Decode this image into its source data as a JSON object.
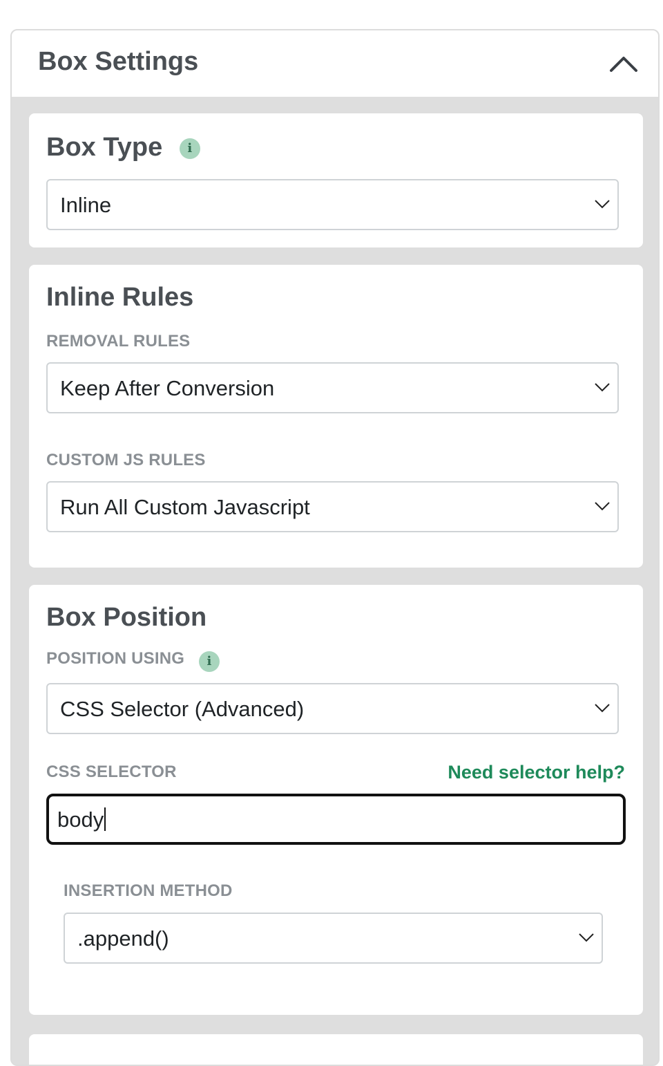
{
  "panel": {
    "title": "Box Settings",
    "collapse_icon": "chevron-up-icon"
  },
  "box_type": {
    "title": "Box Type",
    "info_icon": "info-icon",
    "info_glyph": "i",
    "select_value": "Inline"
  },
  "inline_rules": {
    "title": "Inline Rules",
    "removal_label": "REMOVAL RULES",
    "removal_value": "Keep After Conversion",
    "custom_js_label": "CUSTOM JS RULES",
    "custom_js_value": "Run All Custom Javascript"
  },
  "box_position": {
    "title": "Box Position",
    "position_label": "POSITION USING",
    "info_glyph": "i",
    "position_value": "CSS Selector (Advanced)",
    "css_selector_label": "CSS SELECTOR",
    "help_link": "Need selector help?",
    "css_selector_value": "body",
    "insertion_label": "INSERTION METHOD",
    "insertion_value": ".append()"
  },
  "colors": {
    "accent_green": "#1e8a5a",
    "info_bg": "#a8d5bd",
    "panel_bg": "#dedede"
  }
}
